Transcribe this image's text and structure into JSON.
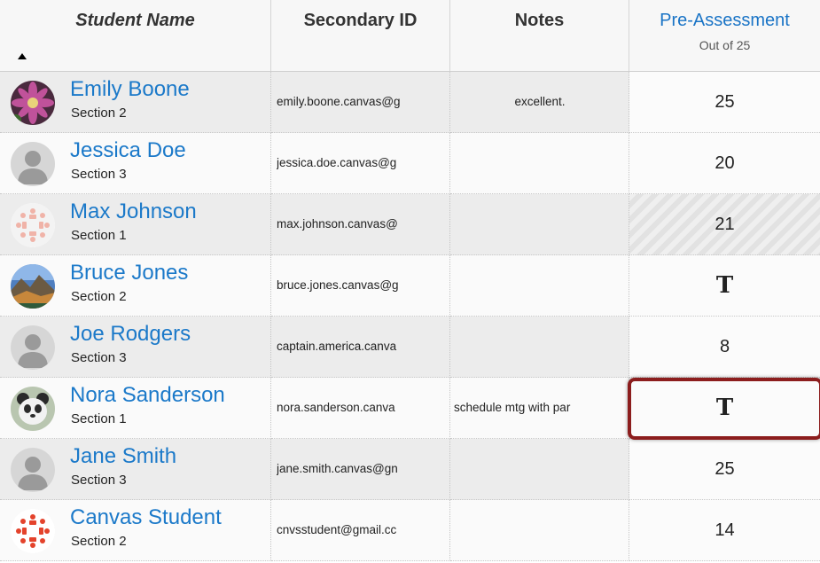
{
  "header": {
    "student_name": "Student Name",
    "secondary_id": "Secondary ID",
    "notes": "Notes",
    "assignment": "Pre-Assessment",
    "assignment_points": "Out of 25"
  },
  "rows": [
    {
      "name": "Emily Boone",
      "section": "Section 2",
      "secondary_id": "emily.boone.canvas@g",
      "notes": "excellent.",
      "grade": "25",
      "avatar": "flower-photo-icon"
    },
    {
      "name": "Jessica Doe",
      "section": "Section 3",
      "secondary_id": "jessica.doe.canvas@g",
      "notes": "",
      "grade": "20",
      "avatar": "default-user-icon"
    },
    {
      "name": "Max Johnson",
      "section": "Section 1",
      "secondary_id": "max.johnson.canvas@",
      "notes": "",
      "grade": "21",
      "avatar": "canvas-logo-light-icon"
    },
    {
      "name": "Bruce Jones",
      "section": "Section 2",
      "secondary_id": "bruce.jones.canvas@g",
      "notes": "",
      "grade": "T",
      "avatar": "landscape-photo-icon"
    },
    {
      "name": "Joe Rodgers",
      "section": "Section 3",
      "secondary_id": "captain.america.canva",
      "notes": "",
      "grade": "8",
      "avatar": "default-user-icon"
    },
    {
      "name": "Nora Sanderson",
      "section": "Section 1",
      "secondary_id": "nora.sanderson.canva",
      "notes": "schedule mtg with par",
      "grade": "T",
      "avatar": "panda-photo-icon"
    },
    {
      "name": "Jane Smith",
      "section": "Section 3",
      "secondary_id": "jane.smith.canvas@gn",
      "notes": "",
      "grade": "25",
      "avatar": "default-user-icon"
    },
    {
      "name": "Canvas Student",
      "section": "Section 2",
      "secondary_id": "cnvsstudent@gmail.cc",
      "notes": "",
      "grade": "14",
      "avatar": "canvas-logo-red-icon"
    }
  ],
  "colors": {
    "link": "#1b79c9",
    "active_outline": "#8c1d1d",
    "canvas_red": "#e4432c"
  }
}
